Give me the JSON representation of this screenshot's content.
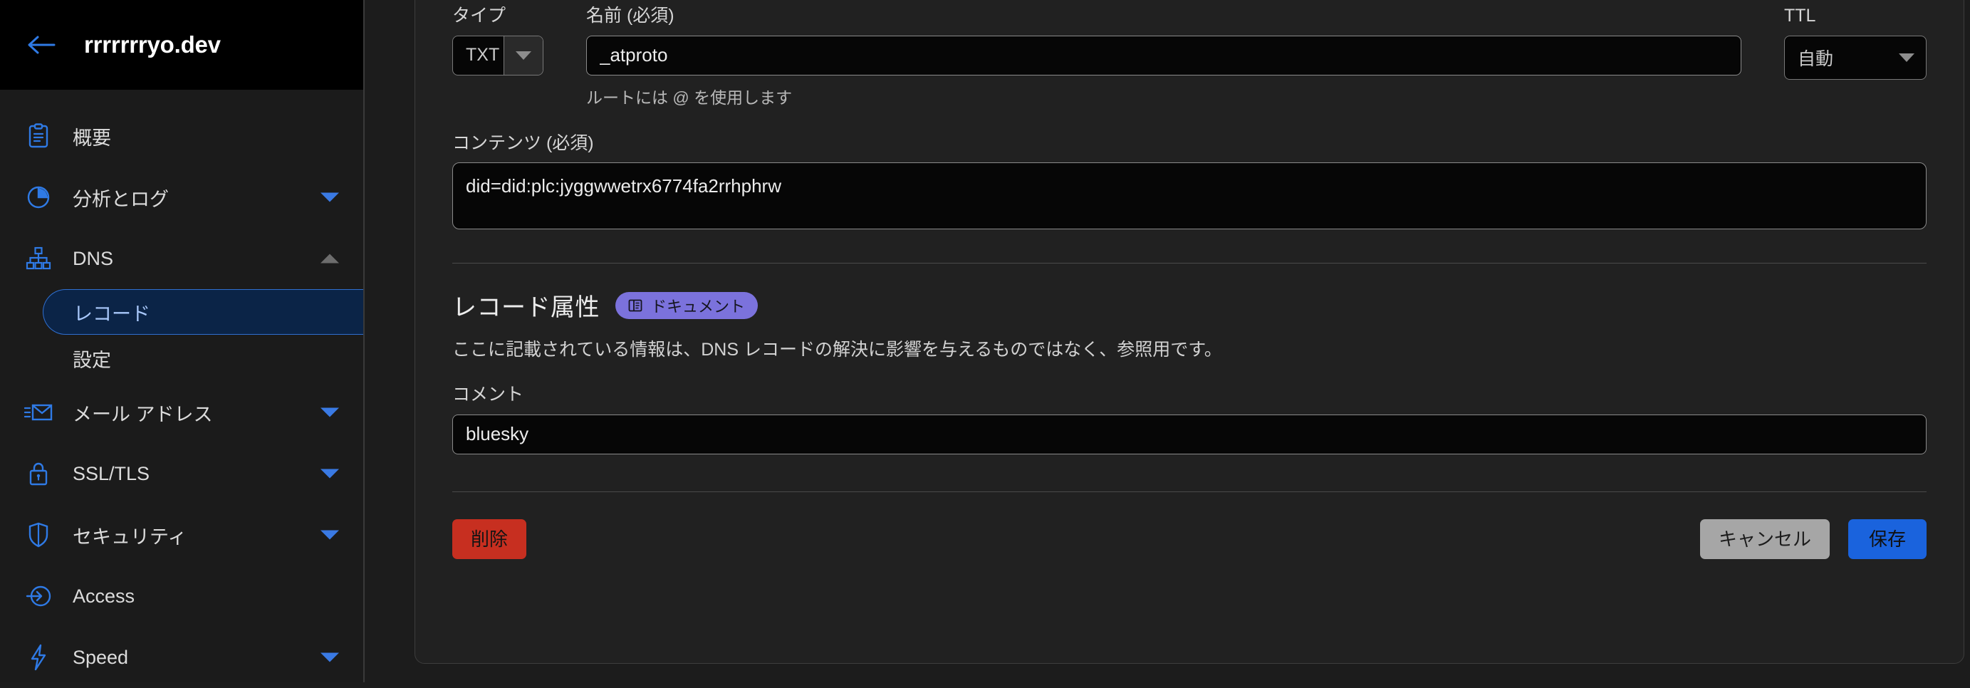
{
  "sidebar": {
    "back_icon": "arrow-left-icon",
    "site_title": "rrrrrrryo.dev",
    "items": [
      {
        "icon": "clipboard-icon",
        "label": "概要",
        "caret": "none"
      },
      {
        "icon": "pie-chart-icon",
        "label": "分析とログ",
        "caret": "down"
      },
      {
        "icon": "sitemap-icon",
        "label": "DNS",
        "caret": "up"
      },
      {
        "icon": "mail-icon",
        "label": "メール アドレス",
        "caret": "down"
      },
      {
        "icon": "lock-icon",
        "label": "SSL/TLS",
        "caret": "down"
      },
      {
        "icon": "shield-icon",
        "label": "セキュリティ",
        "caret": "down"
      },
      {
        "icon": "login-icon",
        "label": "Access",
        "caret": "none"
      },
      {
        "icon": "bolt-icon",
        "label": "Speed",
        "caret": "down"
      }
    ],
    "dns_subitems": [
      {
        "label": "レコード",
        "active": true
      },
      {
        "label": "設定",
        "active": false
      }
    ]
  },
  "form": {
    "type": {
      "label": "タイプ",
      "value": "TXT"
    },
    "name": {
      "label": "名前 (必須)",
      "value": "_atproto",
      "placeholder": "",
      "help": "ルートには @ を使用します"
    },
    "ttl": {
      "label": "TTL",
      "value": "自動"
    },
    "content": {
      "label": "コンテンツ (必須)",
      "value": "did=did:plc:jyggwwetrx6774fa2rrhphrw",
      "placeholder": ""
    }
  },
  "attributes": {
    "title": "レコード属性",
    "badge": {
      "icon": "book-icon",
      "label": "ドキュメント"
    },
    "description": "ここに記載されている情報は、DNS レコードの解決に影響を与えるものではなく、参照用です。",
    "comment": {
      "label": "コメント",
      "value": "bluesky",
      "placeholder": ""
    }
  },
  "footer": {
    "delete_label": "削除",
    "cancel_label": "キャンセル",
    "save_label": "保存"
  },
  "colors": {
    "accent_blue": "#1a63dd",
    "icon_blue": "#2f7ae5",
    "danger_red": "#c72f20",
    "badge_violet": "#7b72dc",
    "active_nav_bg": "#0b2447"
  }
}
